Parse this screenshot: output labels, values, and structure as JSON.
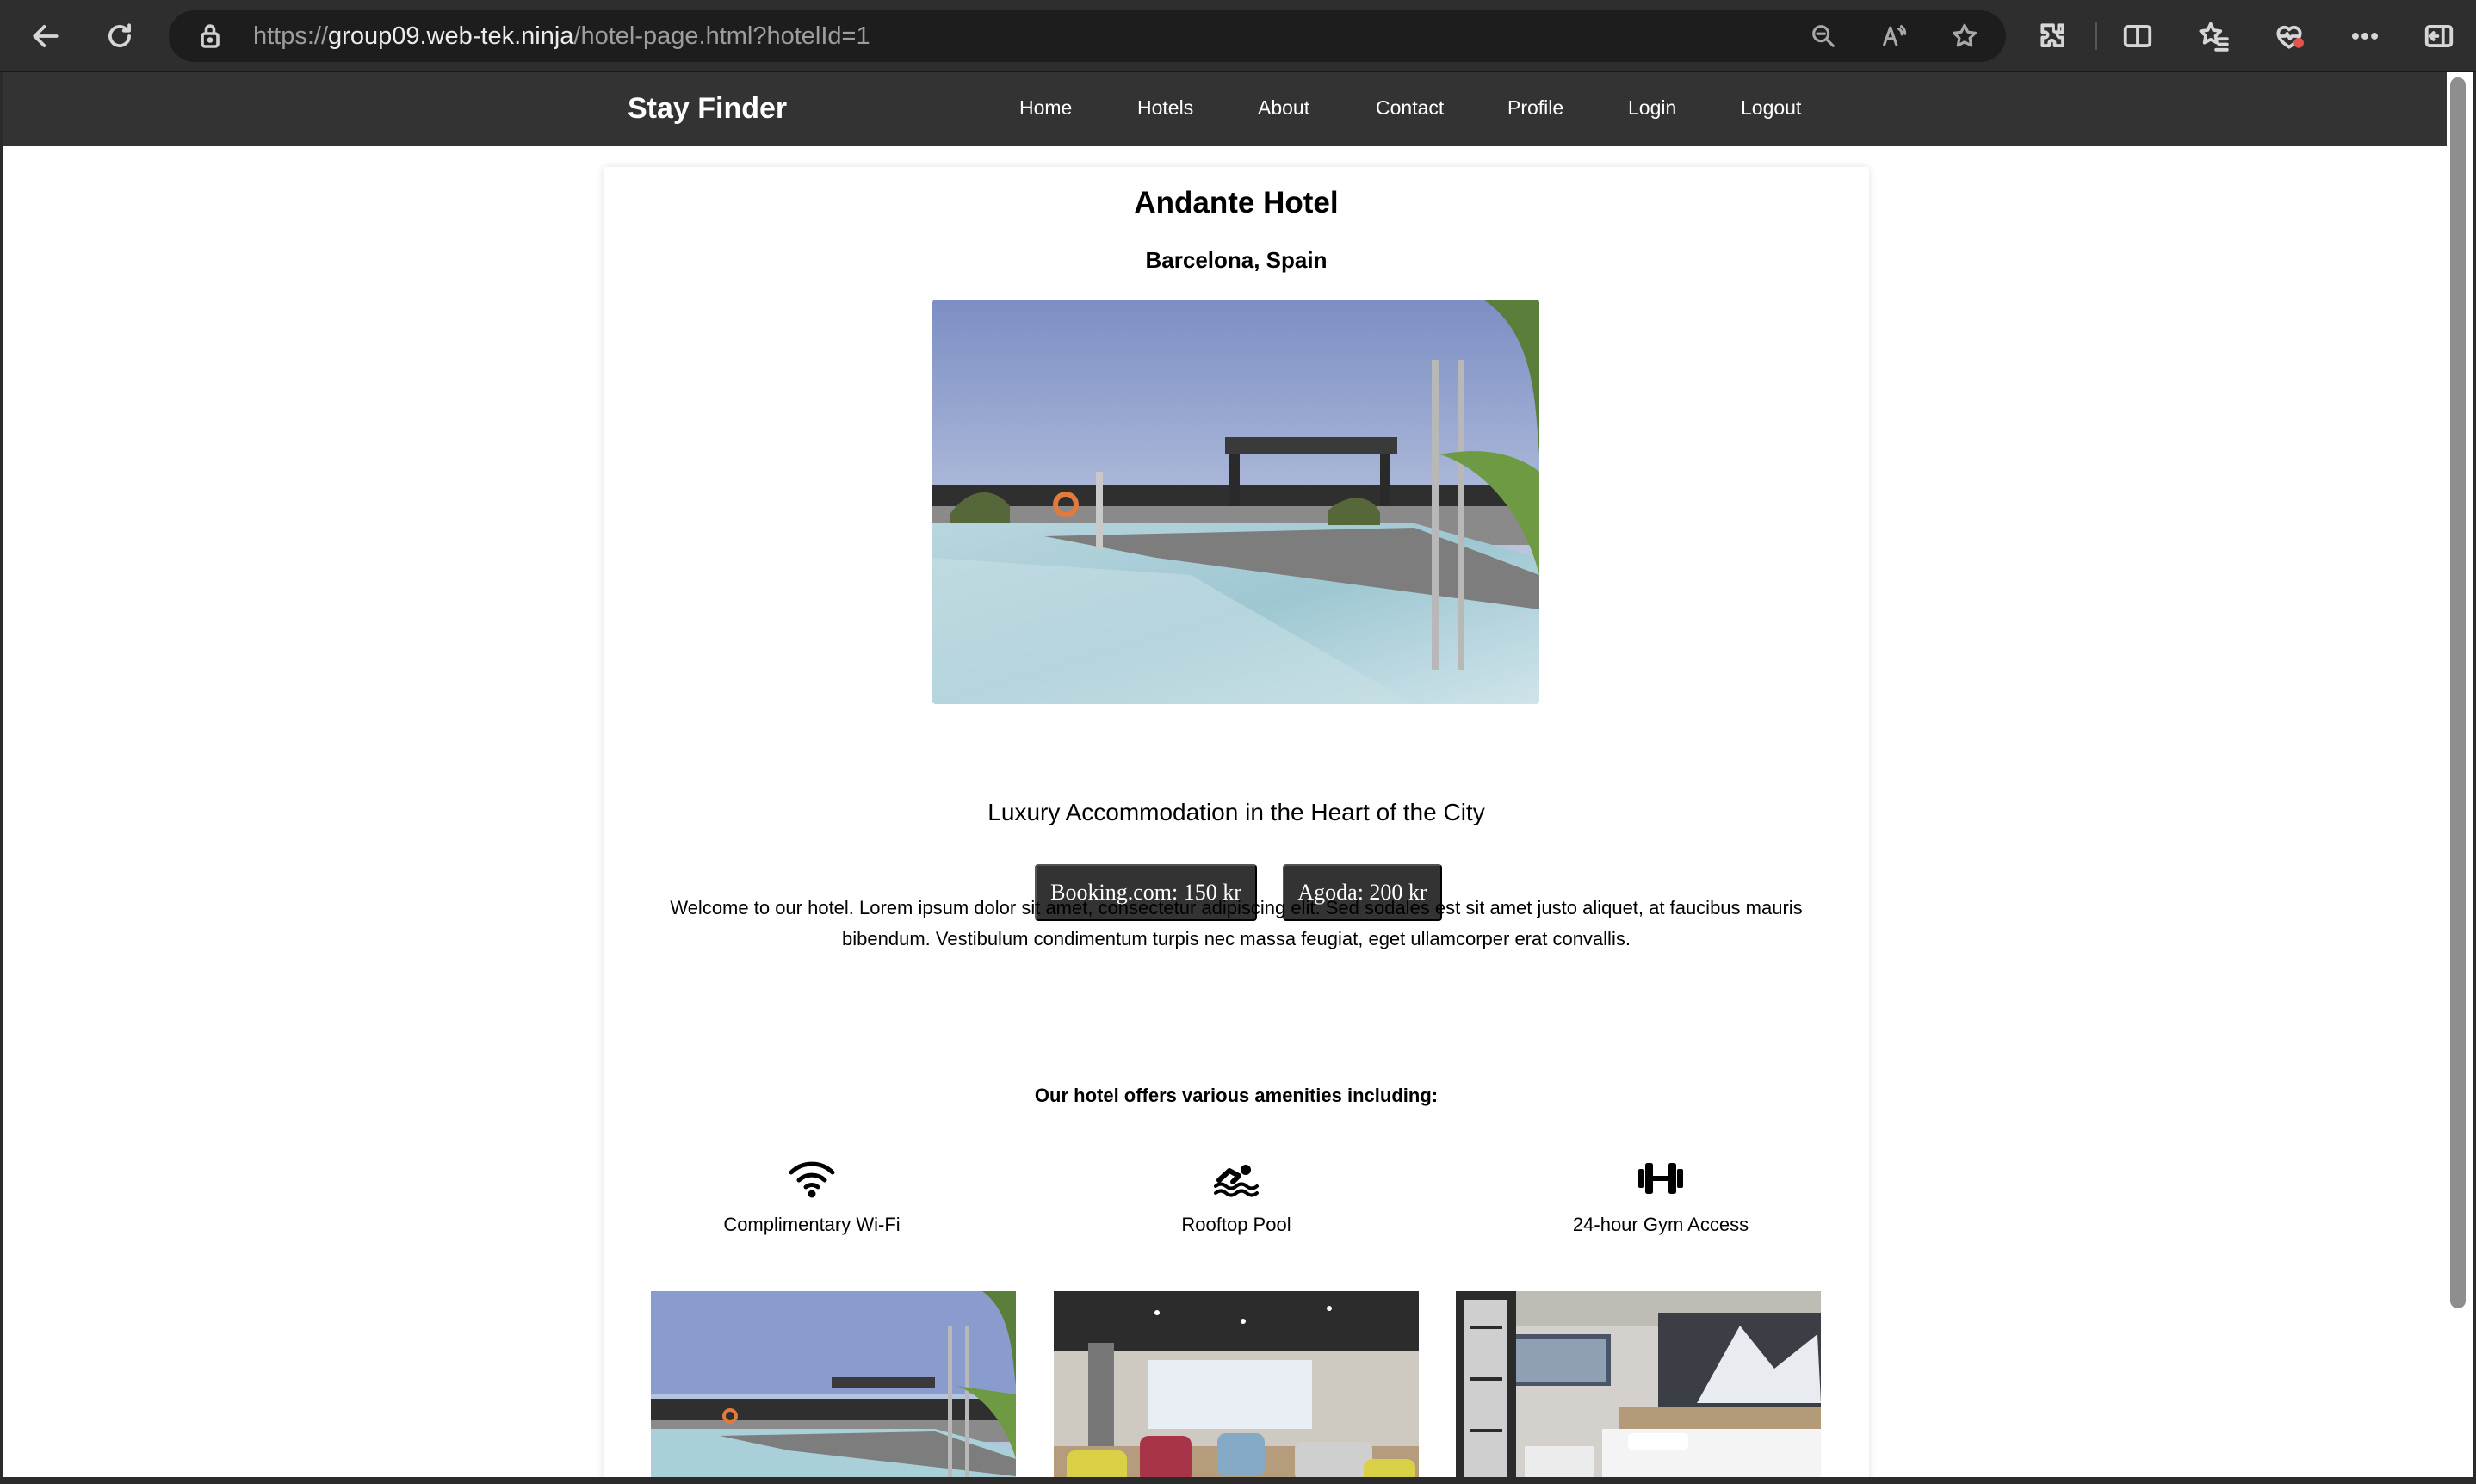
{
  "browser": {
    "url_scheme": "https://",
    "url_host": "group09.web-tek.ninja",
    "url_path": "/hotel-page.html?hotelId=1",
    "icons": [
      "back-icon",
      "refresh-icon",
      "lock-icon",
      "zoom-out-icon",
      "read-aloud-icon",
      "favorite-star-icon",
      "extensions-icon",
      "split-screen-icon",
      "favorites-icon",
      "browser-essentials-icon",
      "more-icon",
      "sidebar-icon"
    ]
  },
  "nav": {
    "brand": "Stay Finder",
    "links": [
      "Home",
      "Hotels",
      "About",
      "Contact",
      "Profile",
      "Login",
      "Logout"
    ]
  },
  "hotel": {
    "name": "Andante Hotel",
    "location": "Barcelona, Spain",
    "tagline": "Luxury Accommodation in the Heart of the City",
    "prices": [
      {
        "label": "Booking.com: 150 kr"
      },
      {
        "label": "Agoda: 200 kr"
      }
    ],
    "description": "Welcome to our hotel. Lorem ipsum dolor sit amet, consectetur adipiscing elit. Sed sodales est sit amet justo aliquet, at faucibus mauris bibendum. Vestibulum condimentum turpis nec massa feugiat, eget ullamcorper erat convallis.",
    "amenities_heading": "Our hotel offers various amenities including:",
    "amenities": [
      {
        "label": "Complimentary Wi-Fi",
        "icon": "wifi-icon"
      },
      {
        "label": "Rooftop Pool",
        "icon": "swimmer-icon"
      },
      {
        "label": "24-hour Gym Access",
        "icon": "dumbbell-icon"
      }
    ],
    "gallery": [
      "rooftop-pool-photo",
      "lobby-lounge-photo",
      "bedroom-photo"
    ]
  },
  "colors": {
    "nav_bg": "#333333",
    "price_button_bg": "#333333",
    "page_bg": "#ffffff",
    "chrome_bg": "#2e2e2e"
  }
}
